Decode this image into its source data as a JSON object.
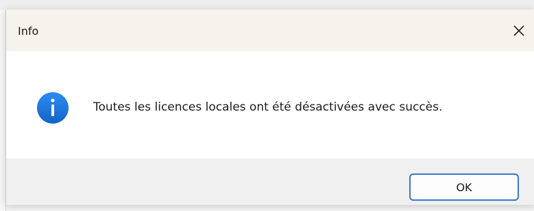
{
  "dialog": {
    "title": "Info",
    "close_icon": "close-icon",
    "message": "Toutes les licences locales ont été désactivées avec succès.",
    "icon": "info-icon",
    "ok_label": "OK"
  },
  "colors": {
    "accent": "#3b77c9",
    "info_icon": "#1a73d9",
    "titlebar": "#f6f2ec",
    "footer": "#f0f0f0"
  }
}
